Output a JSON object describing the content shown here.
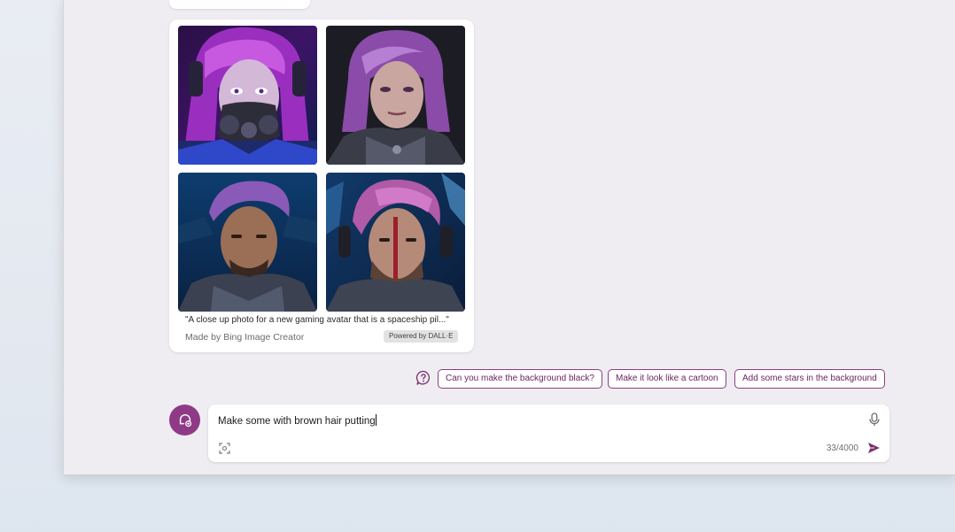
{
  "image_card": {
    "caption": "\"A close up photo for a new gaming avatar that is a spaceship pil...\"",
    "made_by": "Made by Bing Image Creator",
    "powered_by": "Powered by DALL·E"
  },
  "suggestions": {
    "help_icon": "question-bubble-icon",
    "items": [
      "Can you make the background black?",
      "Make it look like a cartoon",
      "Add some stars in the background"
    ]
  },
  "compose": {
    "value": "Make some with brown hair putting",
    "counter": "33/4000",
    "icons": [
      "mic-icon",
      "image-scan-icon",
      "send-icon"
    ]
  },
  "avatar_icon": "new-topic-icon",
  "colors": {
    "accent": "#8f3a86",
    "chip_border": "#8a3f82",
    "chip_text": "#6c2463",
    "window_bg": "#efedf1"
  }
}
